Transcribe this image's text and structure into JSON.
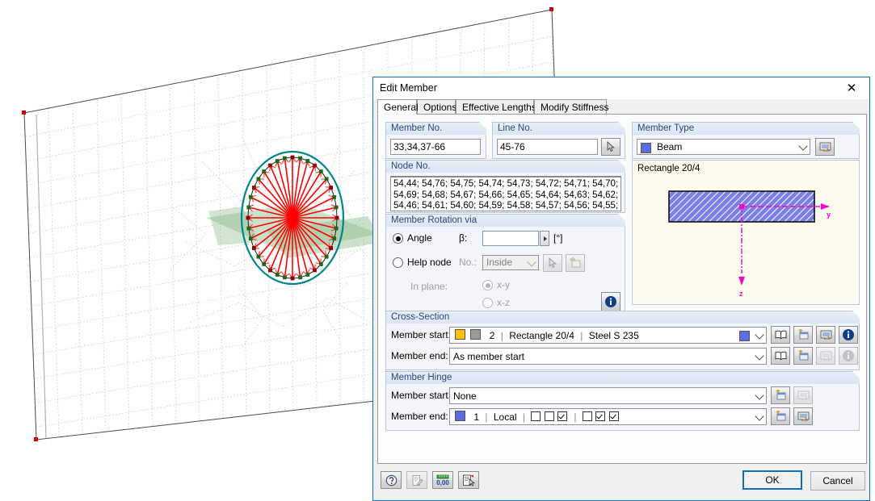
{
  "window": {
    "title": "Edit Member",
    "close_label": "✕"
  },
  "tabs": [
    {
      "label": "General",
      "selected": true
    },
    {
      "label": "Options",
      "selected": false
    },
    {
      "label": "Effective Lengths",
      "selected": false
    },
    {
      "label": "Modify Stiffness",
      "selected": false
    }
  ],
  "member_no": {
    "group_title": "Member No.",
    "value": "33,34,37-66"
  },
  "line_no": {
    "group_title": "Line No.",
    "value": "45-76",
    "pick_icon": "pick-cursor-icon"
  },
  "member_type": {
    "group_title": "Member Type",
    "value": "Beam",
    "color": "#5b6ee1",
    "edit_icon": "edit-dialog-icon"
  },
  "node_no": {
    "group_title": "Node No.",
    "value": "54,44; 54,76; 54,75; 54,74; 54,73; 54,72; 54,71; 54,70;\n54,69; 54,68; 54,67; 54,66; 54,65; 54,64; 54,63; 54,62;\n54,46; 54,61; 54,60; 54,59; 54,58; 54,57; 54,56; 54,55;"
  },
  "member_rotation": {
    "group_title": "Member Rotation via",
    "angle_label": "Angle",
    "angle_selected": true,
    "beta_label": "β:",
    "beta_value": "",
    "beta_unit": "[°]",
    "help_node_label": "Help node",
    "help_node_selected": false,
    "no_label": "No.:",
    "no_value": "Inside",
    "pick_icon": "pick-cursor-icon",
    "new_icon": "new-object-icon",
    "in_plane_label": "In plane:",
    "plane_xy": "x-y",
    "plane_xz": "x-z",
    "plane_selected": "x-y",
    "info_icon": "info-icon"
  },
  "cross_section_preview": {
    "title": "Rectangle 20/4",
    "axis_y_label": "y",
    "axis_z_label": "z",
    "fill_color": "#6a6ee0",
    "axis_color": "#ff00c8"
  },
  "cross_section": {
    "group_title": "Cross-Section",
    "start_label": "Member start:",
    "end_label": "Member end:",
    "start": {
      "color_a": "#ffc000",
      "color_b": "#9a9a9a",
      "no": "2",
      "name": "Rectangle 20/4",
      "material": "Steel S 235",
      "right_color": "#5b6ee1"
    },
    "end_value": "As member start",
    "icons": [
      "library-icon",
      "new-section-icon",
      "edit-dialog-icon",
      "info-icon"
    ]
  },
  "member_hinge": {
    "group_title": "Member Hinge",
    "start_label": "Member start:",
    "end_label": "Member end:",
    "start_value": "None",
    "end": {
      "color": "#5b6ee1",
      "no": "1",
      "system": "Local",
      "group1": [
        false,
        false,
        true
      ],
      "group2": [
        false,
        true,
        true
      ]
    },
    "icons": [
      "new-object-icon",
      "edit-dialog-icon"
    ]
  },
  "bottom_toolbar": {
    "icons": [
      "help-icon",
      "comment-icon",
      "units-icon",
      "print-report-icon"
    ]
  },
  "buttons": {
    "ok": "OK",
    "cancel": "Cancel"
  },
  "viewport": {
    "description": "3D structural model: meshed wall surface with spoked wheel member assembly"
  }
}
